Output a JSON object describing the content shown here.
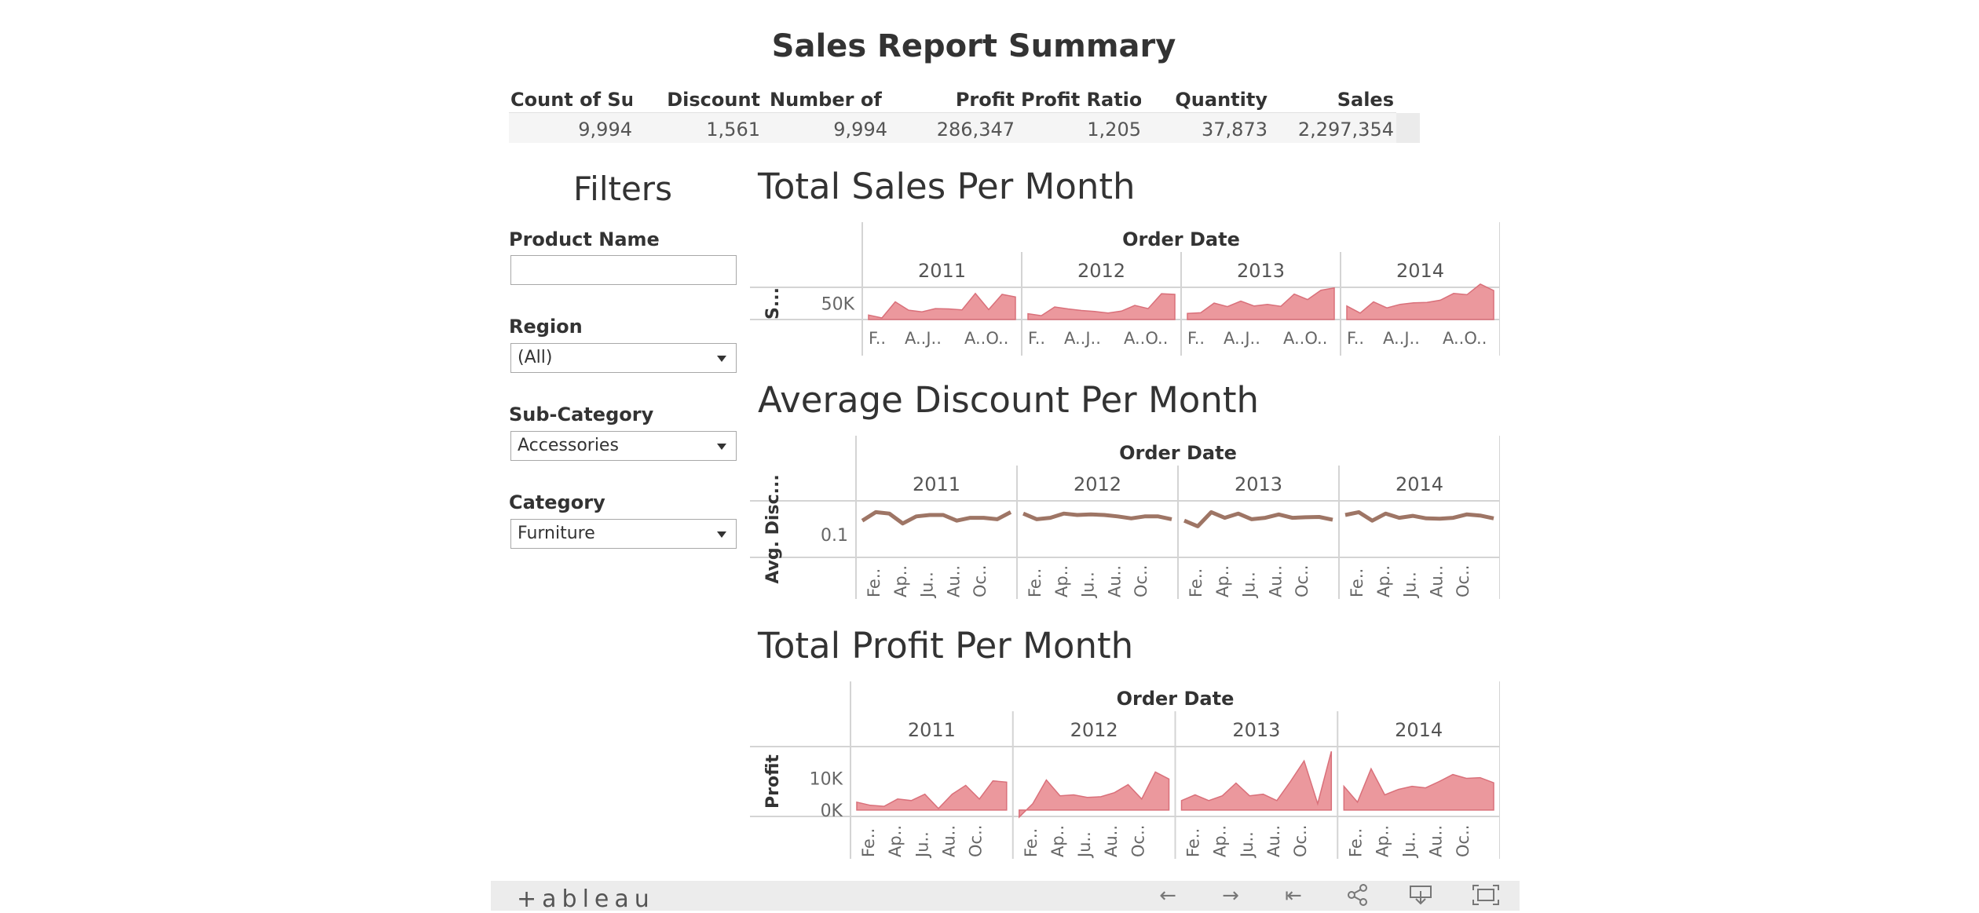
{
  "report_title": "Sales Report Summary",
  "summary": {
    "headers": [
      "Count of Su..",
      "Discount",
      "Number of ..",
      "Profit",
      "Profit Ratio",
      "Quantity",
      "Sales"
    ],
    "values": [
      "9,994",
      "1,561",
      "9,994",
      "286,347",
      "1,205",
      "37,873",
      "2,297,354"
    ]
  },
  "filters": {
    "title": "Filters",
    "product_name": {
      "label": "Product Name",
      "value": ""
    },
    "region": {
      "label": "Region",
      "value": "(All)"
    },
    "sub_category": {
      "label": "Sub-Category",
      "value": "Accessories"
    },
    "category": {
      "label": "Category",
      "value": "Furniture"
    }
  },
  "chart_data": [
    {
      "type": "area",
      "title": "Total Sales Per Month",
      "column_header": "Order Date",
      "years": [
        "2011",
        "2012",
        "2013",
        "2014"
      ],
      "ylabel": "S...",
      "ytick_labels": [
        "50K"
      ],
      "ytick_values": [
        50000
      ],
      "ylim": [
        0,
        100000
      ],
      "month_tick_labels": [
        "F..",
        "A..J..",
        "A..O.."
      ],
      "color": "#e8868c",
      "series": [
        {
          "values": [
            14000,
            5000,
            55000,
            29000,
            24000,
            34000,
            33000,
            30000,
            81000,
            31000,
            78000,
            70000
          ]
        },
        {
          "values": [
            18000,
            12000,
            39000,
            33000,
            28000,
            25000,
            20000,
            26000,
            44000,
            34000,
            80000,
            78000
          ]
        },
        {
          "values": [
            19000,
            21000,
            51000,
            40000,
            57000,
            42000,
            47000,
            41000,
            79000,
            62000,
            91000,
            98000
          ]
        },
        {
          "values": [
            42000,
            20000,
            55000,
            36000,
            47000,
            52000,
            53000,
            60000,
            81000,
            77000,
            110000,
            90000
          ]
        }
      ]
    },
    {
      "type": "line",
      "title": "Average Discount Per Month",
      "column_header": "Order Date",
      "years": [
        "2011",
        "2012",
        "2013",
        "2014"
      ],
      "ylabel": "Avg. Disc...",
      "ytick_labels": [
        "0.1"
      ],
      "ytick_values": [
        0.1
      ],
      "ylim": [
        0.02,
        0.22
      ],
      "month_tick_labels": [
        "Fe..",
        "Ap..",
        "Ju..",
        "Au..",
        "Oc.."
      ],
      "color": "#9e7565",
      "series": [
        {
          "values": [
            0.15,
            0.18,
            0.175,
            0.14,
            0.165,
            0.17,
            0.17,
            0.15,
            0.16,
            0.16,
            0.155,
            0.18
          ]
        },
        {
          "values": [
            0.175,
            0.155,
            0.16,
            0.175,
            0.17,
            0.172,
            0.17,
            0.165,
            0.158,
            0.165,
            0.165,
            0.155
          ]
        },
        {
          "values": [
            0.15,
            0.13,
            0.18,
            0.16,
            0.175,
            0.155,
            0.16,
            0.172,
            0.16,
            0.162,
            0.163,
            0.153
          ]
        },
        {
          "values": [
            0.17,
            0.18,
            0.15,
            0.175,
            0.16,
            0.167,
            0.158,
            0.157,
            0.16,
            0.172,
            0.168,
            0.158
          ]
        }
      ]
    },
    {
      "type": "area",
      "title": "Total Profit Per Month",
      "column_header": "Order Date",
      "years": [
        "2011",
        "2012",
        "2013",
        "2014"
      ],
      "ylabel": "Profit",
      "ytick_labels": [
        "10K",
        "0K"
      ],
      "ytick_values": [
        10000,
        0
      ],
      "ylim": [
        -2000,
        20000
      ],
      "month_tick_labels": [
        "Fe..",
        "Ap..",
        "Ju..",
        "Au..",
        "Oc.."
      ],
      "color": "#e8868c",
      "series": [
        {
          "values": [
            2500,
            1500,
            1200,
            3500,
            3000,
            5000,
            500,
            5000,
            7800,
            3500,
            9200,
            8800
          ]
        },
        {
          "values": [
            -2200,
            2000,
            9500,
            4500,
            4800,
            4000,
            4200,
            5500,
            8000,
            3500,
            12000,
            9800
          ]
        },
        {
          "values": [
            3000,
            4800,
            3000,
            4500,
            8500,
            4500,
            5000,
            3000,
            9000,
            15500,
            2000,
            18500
          ]
        },
        {
          "values": [
            7500,
            2500,
            13000,
            4800,
            6500,
            7500,
            7000,
            9000,
            11200,
            10000,
            10200,
            8600
          ]
        }
      ]
    }
  ],
  "toolbar": {
    "brand": "+ableau",
    "icons": [
      "undo-icon",
      "redo-icon",
      "revert-icon",
      "share-icon",
      "download-icon",
      "fullscreen-icon"
    ]
  }
}
